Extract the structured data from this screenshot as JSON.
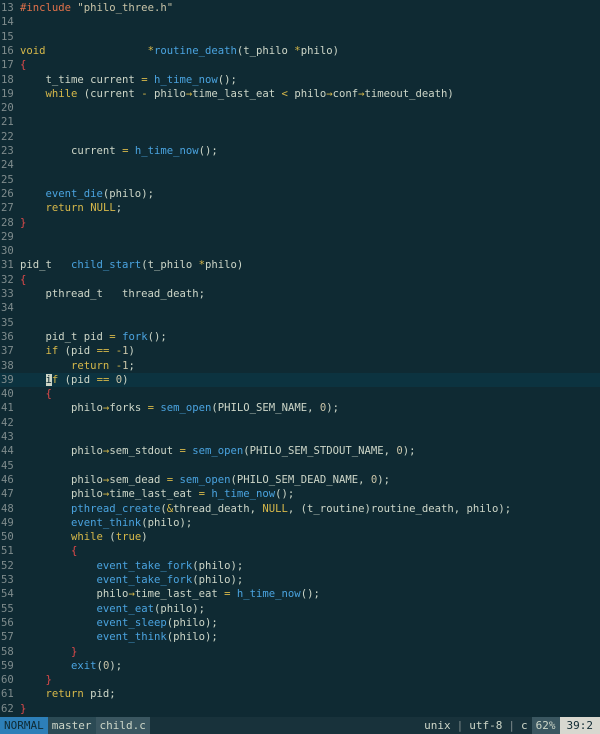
{
  "editor": {
    "current_line": 39,
    "lines": [
      {
        "n": "13",
        "t": [
          [
            "pp",
            "#include "
          ],
          [
            "str",
            "\"philo_three.h\""
          ]
        ]
      },
      {
        "n": "14",
        "t": []
      },
      {
        "n": "15",
        "t": []
      },
      {
        "n": "16",
        "t": [
          [
            "kw",
            "void"
          ],
          [
            "p",
            "                "
          ],
          [
            "op",
            "*"
          ],
          [
            "fn",
            "routine_death"
          ],
          [
            "p",
            "(t_philo "
          ],
          [
            "op",
            "*"
          ],
          [
            "p",
            "philo)"
          ]
        ]
      },
      {
        "n": "17",
        "t": [
          [
            "brace",
            "{"
          ]
        ]
      },
      {
        "n": "18",
        "t": [
          [
            "p",
            "    t_time current "
          ],
          [
            "op",
            "="
          ],
          [
            "p",
            " "
          ],
          [
            "fn",
            "h_time_now"
          ],
          [
            "p",
            "();"
          ]
        ]
      },
      {
        "n": "19",
        "t": [
          [
            "p",
            "    "
          ],
          [
            "kw",
            "while"
          ],
          [
            "p",
            " (current "
          ],
          [
            "op",
            "-"
          ],
          [
            "p",
            " philo"
          ],
          [
            "op",
            "→"
          ],
          [
            "p",
            "time_last_eat "
          ],
          [
            "op",
            "<"
          ],
          [
            "p",
            " philo"
          ],
          [
            "op",
            "→"
          ],
          [
            "p",
            "conf"
          ],
          [
            "op",
            "→"
          ],
          [
            "p",
            "timeout_death)"
          ]
        ]
      },
      {
        "n": "20",
        "t": []
      },
      {
        "n": "21",
        "t": []
      },
      {
        "n": "22",
        "t": []
      },
      {
        "n": "23",
        "t": [
          [
            "p",
            "        current "
          ],
          [
            "op",
            "="
          ],
          [
            "p",
            " "
          ],
          [
            "fn",
            "h_time_now"
          ],
          [
            "p",
            "();"
          ]
        ]
      },
      {
        "n": "24",
        "t": []
      },
      {
        "n": "25",
        "t": []
      },
      {
        "n": "26",
        "t": [
          [
            "p",
            "    "
          ],
          [
            "fn",
            "event_die"
          ],
          [
            "p",
            "(philo);"
          ]
        ]
      },
      {
        "n": "27",
        "t": [
          [
            "p",
            "    "
          ],
          [
            "kw",
            "return"
          ],
          [
            "p",
            " "
          ],
          [
            "kw",
            "NULL"
          ],
          [
            "p",
            ";"
          ]
        ]
      },
      {
        "n": "28",
        "t": [
          [
            "brace",
            "}"
          ]
        ]
      },
      {
        "n": "29",
        "t": []
      },
      {
        "n": "30",
        "t": []
      },
      {
        "n": "31",
        "t": [
          [
            "p",
            "pid_t   "
          ],
          [
            "fn",
            "child_start"
          ],
          [
            "p",
            "(t_philo "
          ],
          [
            "op",
            "*"
          ],
          [
            "p",
            "philo)"
          ]
        ]
      },
      {
        "n": "32",
        "t": [
          [
            "brace",
            "{"
          ]
        ]
      },
      {
        "n": "33",
        "t": [
          [
            "p",
            "    pthread_t   thread_death;"
          ]
        ]
      },
      {
        "n": "34",
        "t": []
      },
      {
        "n": "35",
        "t": []
      },
      {
        "n": "36",
        "t": [
          [
            "p",
            "    pid_t pid "
          ],
          [
            "op",
            "="
          ],
          [
            "p",
            " "
          ],
          [
            "fn",
            "fork"
          ],
          [
            "p",
            "();"
          ]
        ]
      },
      {
        "n": "37",
        "t": [
          [
            "p",
            "    "
          ],
          [
            "kw",
            "if"
          ],
          [
            "p",
            " (pid "
          ],
          [
            "op",
            "=="
          ],
          [
            "p",
            " "
          ],
          [
            "op",
            "-"
          ],
          [
            "num",
            "1"
          ],
          [
            "p",
            ")"
          ]
        ]
      },
      {
        "n": "38",
        "t": [
          [
            "p",
            "        "
          ],
          [
            "kw",
            "return"
          ],
          [
            "p",
            " "
          ],
          [
            "op",
            "-"
          ],
          [
            "num",
            "1"
          ],
          [
            "p",
            ";"
          ]
        ]
      },
      {
        "n": "39",
        "t": [
          [
            "p",
            "    "
          ],
          [
            "cursor",
            "i"
          ],
          [
            "kw",
            "f"
          ],
          [
            "p",
            " (pid "
          ],
          [
            "op",
            "=="
          ],
          [
            "p",
            " "
          ],
          [
            "num",
            "0"
          ],
          [
            "p",
            ")"
          ]
        ]
      },
      {
        "n": "40",
        "t": [
          [
            "p",
            "    "
          ],
          [
            "brace",
            "{"
          ]
        ]
      },
      {
        "n": "41",
        "t": [
          [
            "p",
            "        philo"
          ],
          [
            "op",
            "→"
          ],
          [
            "p",
            "forks "
          ],
          [
            "op",
            "="
          ],
          [
            "p",
            " "
          ],
          [
            "fn",
            "sem_open"
          ],
          [
            "p",
            "(PHILO_SEM_NAME, "
          ],
          [
            "num",
            "0"
          ],
          [
            "p",
            ");"
          ]
        ]
      },
      {
        "n": "42",
        "t": []
      },
      {
        "n": "43",
        "t": []
      },
      {
        "n": "44",
        "t": [
          [
            "p",
            "        philo"
          ],
          [
            "op",
            "→"
          ],
          [
            "p",
            "sem_stdout "
          ],
          [
            "op",
            "="
          ],
          [
            "p",
            " "
          ],
          [
            "fn",
            "sem_open"
          ],
          [
            "p",
            "(PHILO_SEM_STDOUT_NAME, "
          ],
          [
            "num",
            "0"
          ],
          [
            "p",
            ");"
          ]
        ]
      },
      {
        "n": "45",
        "t": []
      },
      {
        "n": "46",
        "t": [
          [
            "p",
            "        philo"
          ],
          [
            "op",
            "→"
          ],
          [
            "p",
            "sem_dead "
          ],
          [
            "op",
            "="
          ],
          [
            "p",
            " "
          ],
          [
            "fn",
            "sem_open"
          ],
          [
            "p",
            "(PHILO_SEM_DEAD_NAME, "
          ],
          [
            "num",
            "0"
          ],
          [
            "p",
            ");"
          ]
        ]
      },
      {
        "n": "47",
        "t": [
          [
            "p",
            "        philo"
          ],
          [
            "op",
            "→"
          ],
          [
            "p",
            "time_last_eat "
          ],
          [
            "op",
            "="
          ],
          [
            "p",
            " "
          ],
          [
            "fn",
            "h_time_now"
          ],
          [
            "p",
            "();"
          ]
        ]
      },
      {
        "n": "48",
        "t": [
          [
            "p",
            "        "
          ],
          [
            "fn",
            "pthread_create"
          ],
          [
            "p",
            "("
          ],
          [
            "op",
            "&"
          ],
          [
            "p",
            "thread_death, "
          ],
          [
            "kw",
            "NULL"
          ],
          [
            "p",
            ", (t_routine)routine_death, philo);"
          ]
        ]
      },
      {
        "n": "49",
        "t": [
          [
            "p",
            "        "
          ],
          [
            "fn",
            "event_think"
          ],
          [
            "p",
            "(philo);"
          ]
        ]
      },
      {
        "n": "50",
        "t": [
          [
            "p",
            "        "
          ],
          [
            "kw",
            "while"
          ],
          [
            "p",
            " ("
          ],
          [
            "kw",
            "true"
          ],
          [
            "p",
            ")"
          ]
        ]
      },
      {
        "n": "51",
        "t": [
          [
            "p",
            "        "
          ],
          [
            "brace",
            "{"
          ]
        ]
      },
      {
        "n": "52",
        "t": [
          [
            "p",
            "            "
          ],
          [
            "fn",
            "event_take_fork"
          ],
          [
            "p",
            "(philo);"
          ]
        ]
      },
      {
        "n": "53",
        "t": [
          [
            "p",
            "            "
          ],
          [
            "fn",
            "event_take_fork"
          ],
          [
            "p",
            "(philo);"
          ]
        ]
      },
      {
        "n": "54",
        "t": [
          [
            "p",
            "            philo"
          ],
          [
            "op",
            "→"
          ],
          [
            "p",
            "time_last_eat "
          ],
          [
            "op",
            "="
          ],
          [
            "p",
            " "
          ],
          [
            "fn",
            "h_time_now"
          ],
          [
            "p",
            "();"
          ]
        ]
      },
      {
        "n": "55",
        "t": [
          [
            "p",
            "            "
          ],
          [
            "fn",
            "event_eat"
          ],
          [
            "p",
            "(philo);"
          ]
        ]
      },
      {
        "n": "56",
        "t": [
          [
            "p",
            "            "
          ],
          [
            "fn",
            "event_sleep"
          ],
          [
            "p",
            "(philo);"
          ]
        ]
      },
      {
        "n": "57",
        "t": [
          [
            "p",
            "            "
          ],
          [
            "fn",
            "event_think"
          ],
          [
            "p",
            "(philo);"
          ]
        ]
      },
      {
        "n": "58",
        "t": [
          [
            "p",
            "        "
          ],
          [
            "brace",
            "}"
          ]
        ]
      },
      {
        "n": "59",
        "t": [
          [
            "p",
            "        "
          ],
          [
            "fn",
            "exit"
          ],
          [
            "p",
            "("
          ],
          [
            "num",
            "0"
          ],
          [
            "p",
            ");"
          ]
        ]
      },
      {
        "n": "60",
        "t": [
          [
            "p",
            "    "
          ],
          [
            "brace",
            "}"
          ]
        ]
      },
      {
        "n": "61",
        "t": [
          [
            "p",
            "    "
          ],
          [
            "kw",
            "return"
          ],
          [
            "p",
            " pid;"
          ]
        ]
      },
      {
        "n": "62",
        "t": [
          [
            "brace",
            "}"
          ]
        ]
      }
    ]
  },
  "statusbar": {
    "mode": "NORMAL",
    "branch": "master",
    "file": "child.c",
    "fileformat": "unix",
    "encoding": "utf-8",
    "filetype": "c",
    "percent": "62%",
    "position": "39:2"
  },
  "colors": {
    "background": "#0f2a33",
    "keyword": "#d6b84a",
    "function": "#4aa3df",
    "preprocessor": "#e0714a",
    "brace": "#e04a4a",
    "mode_bg": "#2d7fb8"
  }
}
